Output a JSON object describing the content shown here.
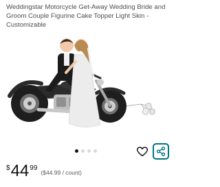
{
  "product": {
    "title": "Weddingstar Motorcycle Get-Away Wedding Bride and Groom Couple Figurine Cake Topper Light Skin - Customizable"
  },
  "gallery": {
    "image_subject": "bride-and-groom-motorcycle-figurine",
    "dot_count": 4,
    "active_dot": 1
  },
  "actions": {
    "favorite_icon": "heart-icon",
    "share_icon": "share-icon",
    "accent_color": "#007185"
  },
  "price": {
    "currency": "$",
    "whole": "44",
    "fraction": "99",
    "per_unit": "($44.99 / count)"
  }
}
